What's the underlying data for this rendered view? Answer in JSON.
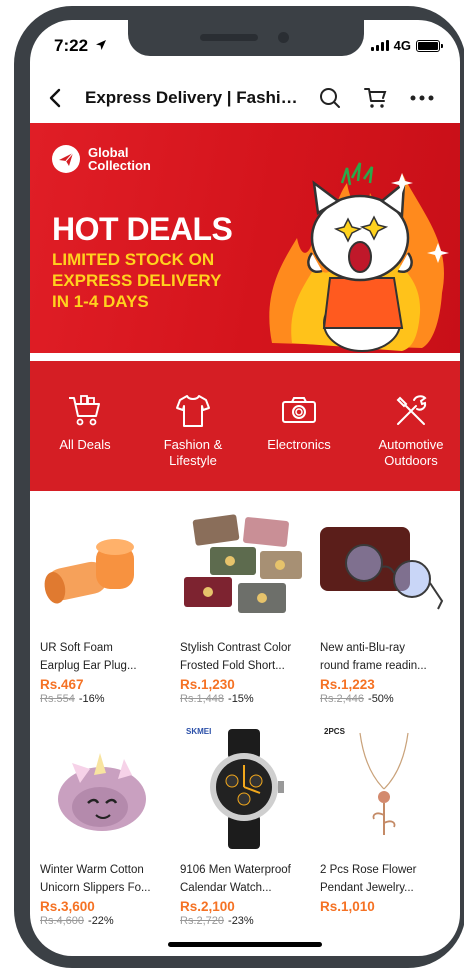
{
  "status_bar": {
    "time": "7:22",
    "network": "4G"
  },
  "nav": {
    "title": "Express Delivery | Fashion..."
  },
  "banner": {
    "brand": "Global Collection",
    "headline": "HOT DEALS",
    "tagline_line1": "LIMITED STOCK ON",
    "tagline_line2": "EXPRESS DELIVERY",
    "tagline_line3": "IN 1-4 DAYS"
  },
  "categories": [
    {
      "line1": "All Deals",
      "line2": ""
    },
    {
      "line1": "Fashion &",
      "line2": "Lifestyle"
    },
    {
      "line1": "Electronics",
      "line2": ""
    },
    {
      "line1": "Automotive",
      "line2": "Outdoors"
    }
  ],
  "products": [
    {
      "title1": "UR Soft Foam",
      "title2": "Earplug Ear Plug...",
      "price": "Rs.467",
      "old_price": "Rs.554",
      "discount": "-16%"
    },
    {
      "title1": "Stylish Contrast Color",
      "title2": "Frosted Fold Short...",
      "price": "Rs.1,230",
      "old_price": "Rs.1,448",
      "discount": "-15%"
    },
    {
      "title1": "New anti-Blu-ray",
      "title2": "round frame readin...",
      "price": "Rs.1,223",
      "old_price": "Rs.2,446",
      "discount": "-50%"
    },
    {
      "title1": "Winter Warm Cotton",
      "title2": "Unicorn Slippers Fo...",
      "price": "Rs.3,600",
      "old_price": "Rs.4,600",
      "discount": "-22%"
    },
    {
      "title1": "9106 Men Waterproof",
      "title2": "Calendar Watch...",
      "price": "Rs.2,100",
      "old_price": "Rs.2,720",
      "discount": "-23%"
    },
    {
      "title1": "2 Pcs Rose Flower",
      "title2": "Pendant Jewelry...",
      "price": "Rs.1,010",
      "old_price": "",
      "discount": ""
    }
  ],
  "product_labels": {
    "watch_brand": "SKMEI",
    "pendant_tag": "2PCS"
  },
  "colors": {
    "brand_red": "#d51e24",
    "price_orange": "#f57224",
    "tagline_yellow": "#ffd21e"
  }
}
